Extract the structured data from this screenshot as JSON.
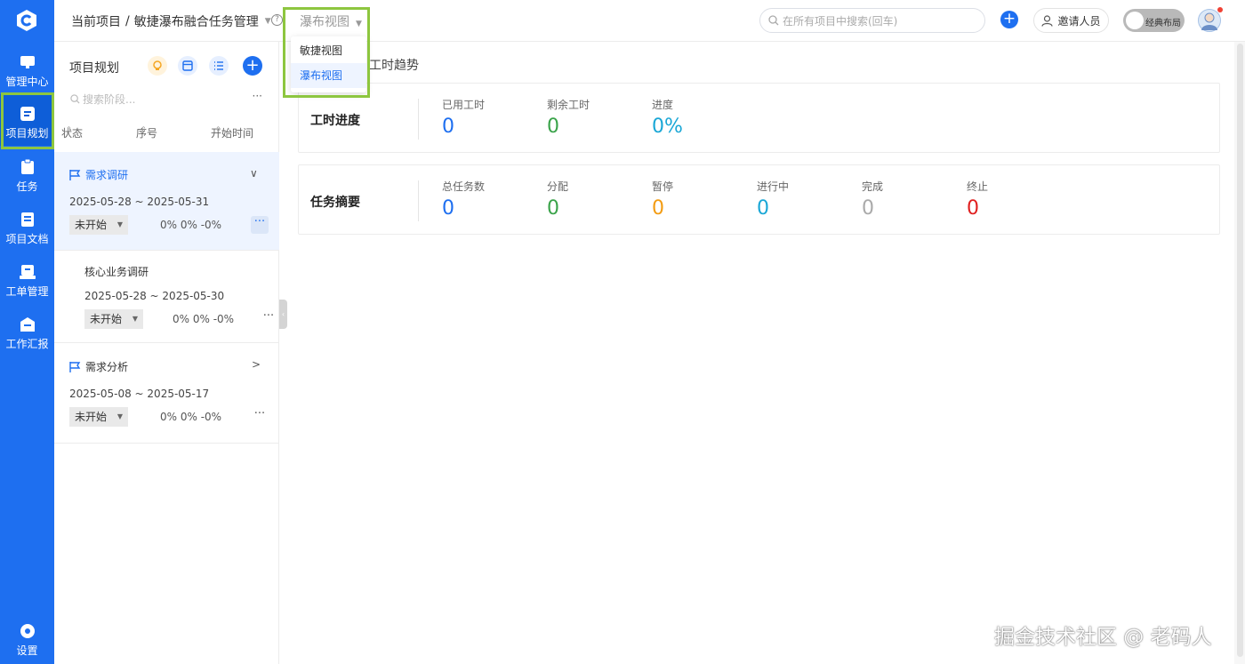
{
  "nav": {
    "logo": "app-logo",
    "items": [
      {
        "label": "管理中心",
        "icon": "monitor-icon"
      },
      {
        "label": "项目规划",
        "icon": "document-icon",
        "active": true
      },
      {
        "label": "任务",
        "icon": "clipboard-icon"
      },
      {
        "label": "项目文档",
        "icon": "docs-icon"
      },
      {
        "label": "工单管理",
        "icon": "ticket-icon"
      },
      {
        "label": "工作汇报",
        "icon": "inbox-icon"
      }
    ],
    "settings_label": "设置"
  },
  "header": {
    "breadcrumb_root": "当前项目",
    "breadcrumb_sep": "/",
    "project_name": "敏捷瀑布融合任务管理",
    "view_selected": "瀑布视图",
    "view_options": [
      "敏捷视图",
      "瀑布视图"
    ],
    "search_placeholder": "在所有项目中搜索(回车)",
    "invite_label": "邀请人员",
    "layout_toggle_label": "经典布局"
  },
  "plan": {
    "title": "项目规划",
    "search_placeholder": "搜索阶段...",
    "columns": [
      "状态",
      "序号",
      "开始时间"
    ],
    "stages": [
      {
        "name": "需求调研",
        "dates": "2025-05-28 ~ 2025-05-31",
        "status": "未开始",
        "progress": "0% 0% -0%"
      },
      {
        "name": "核心业务调研",
        "dates": "2025-05-28 ~ 2025-05-30",
        "status": "未开始",
        "progress": "0% 0% -0%"
      },
      {
        "name": "需求分析",
        "dates": "2025-05-08 ~ 2025-05-17",
        "status": "未开始",
        "progress": "0% 0% -0%"
      }
    ]
  },
  "main": {
    "trend_tab": "工时趋势",
    "hours": {
      "title": "工时进度",
      "stats": [
        {
          "label": "已用工时",
          "value": "0",
          "color": "#1e6ff0"
        },
        {
          "label": "剩余工时",
          "value": "0",
          "color": "#3aa34a"
        },
        {
          "label": "进度",
          "value": "0%",
          "color": "#1aa7d6"
        }
      ]
    },
    "summary": {
      "title": "任务摘要",
      "stats": [
        {
          "label": "总任务数",
          "value": "0",
          "color": "#1e6ff0"
        },
        {
          "label": "分配",
          "value": "0",
          "color": "#3aa34a"
        },
        {
          "label": "暂停",
          "value": "0",
          "color": "#f39c12"
        },
        {
          "label": "进行中",
          "value": "0",
          "color": "#1aa7d6"
        },
        {
          "label": "完成",
          "value": "0",
          "color": "#aaaaaa"
        },
        {
          "label": "终止",
          "value": "0",
          "color": "#e02020"
        }
      ]
    }
  },
  "watermark": "掘金技术社区 @ 老码人",
  "colors": {
    "brand": "#1e6ff0",
    "highlight": "#8dc63f"
  }
}
